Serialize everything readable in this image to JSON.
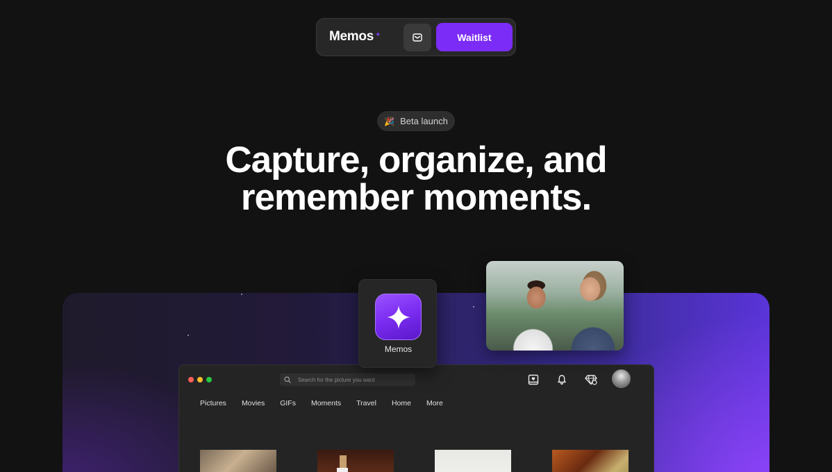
{
  "nav": {
    "logo": "Memos",
    "logo_spark": "✦",
    "waitlist_label": "Waitlist"
  },
  "hero": {
    "badge_icon": "🎉",
    "badge_label": "Beta launch",
    "headline": "Capture, organize, and remember moments."
  },
  "app_card": {
    "label": "Memos"
  },
  "window": {
    "search_placeholder": "Search for the picture you want",
    "tabs": [
      "Pictures",
      "Movies",
      "GIFs",
      "Moments",
      "Travel",
      "Home",
      "More"
    ]
  },
  "colors": {
    "accent": "#7c2cf7",
    "background": "#121212"
  }
}
